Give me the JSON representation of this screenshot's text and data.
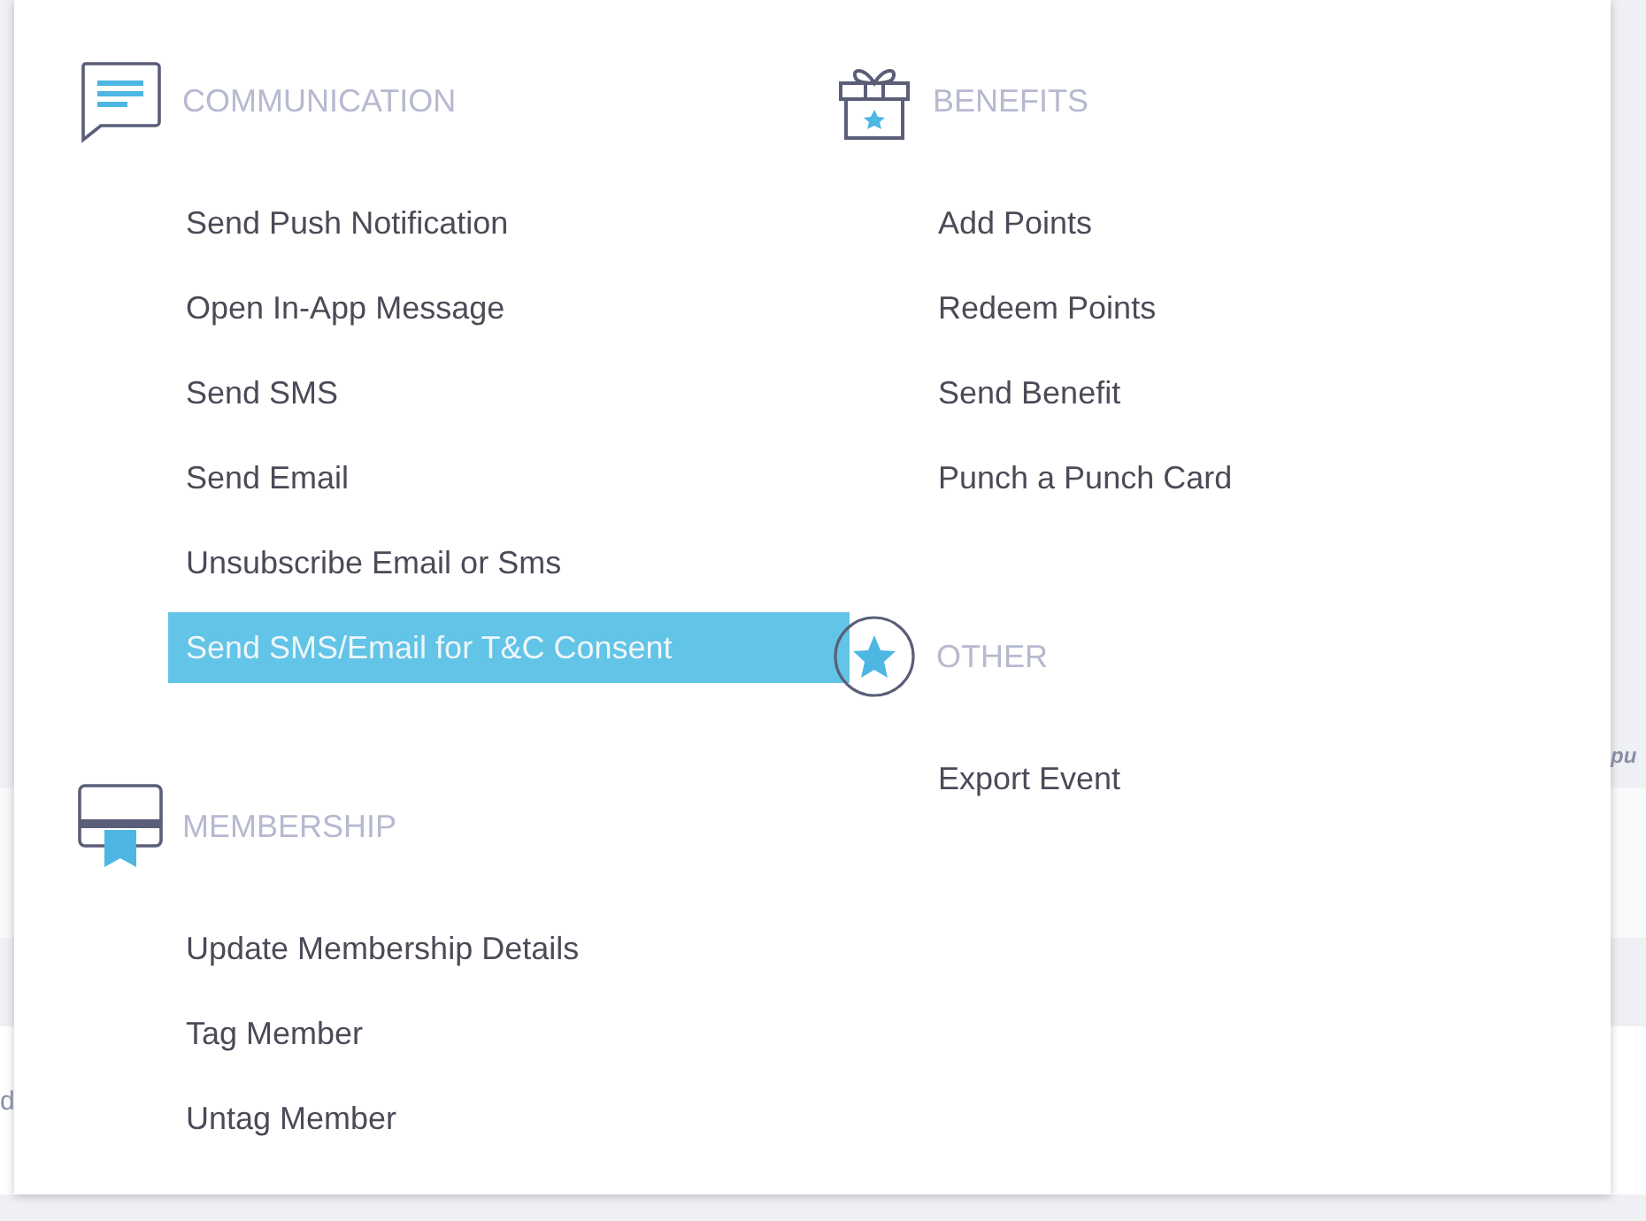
{
  "background_fragments": [
    {
      "text": "d"
    },
    {
      "text": "pu"
    }
  ],
  "columns": [
    [
      {
        "kind": "communication",
        "title": "COMMUNICATION",
        "items": [
          {
            "label": "Send Push Notification",
            "selected": false
          },
          {
            "label": "Open In-App Message",
            "selected": false
          },
          {
            "label": "Send SMS",
            "selected": false
          },
          {
            "label": "Send Email",
            "selected": false
          },
          {
            "label": "Unsubscribe Email or Sms",
            "selected": false
          },
          {
            "label": "Send SMS/Email for T&C Consent",
            "selected": true
          }
        ]
      },
      {
        "kind": "membership",
        "title": "MEMBERSHIP",
        "items": [
          {
            "label": "Update Membership Details",
            "selected": false
          },
          {
            "label": "Tag Member",
            "selected": false
          },
          {
            "label": "Untag Member",
            "selected": false
          }
        ]
      }
    ],
    [
      {
        "kind": "benefits",
        "title": "BENEFITS",
        "items": [
          {
            "label": "Add Points",
            "selected": false
          },
          {
            "label": "Redeem Points",
            "selected": false
          },
          {
            "label": "Send Benefit",
            "selected": false
          },
          {
            "label": "Punch a Punch Card",
            "selected": false
          }
        ]
      },
      {
        "kind": "other",
        "title": "OTHER",
        "items": [
          {
            "label": "Export Event",
            "selected": false
          }
        ]
      }
    ]
  ]
}
